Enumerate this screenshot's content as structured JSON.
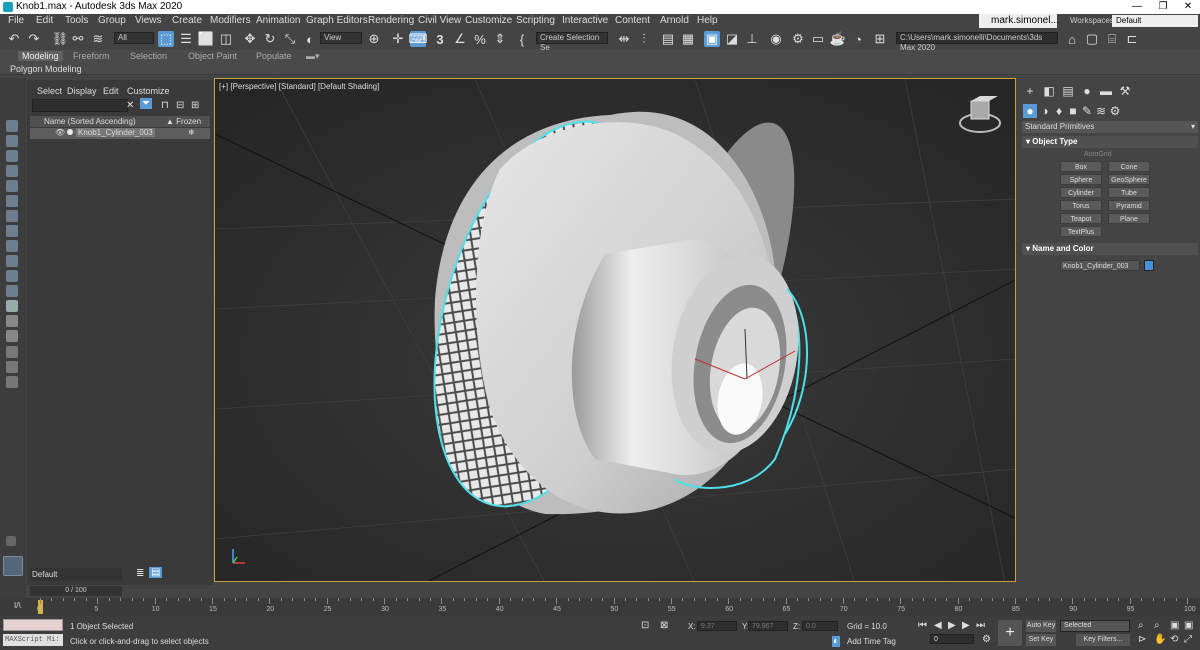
{
  "titlebar": {
    "title": "Knob1.max - Autodesk 3ds Max 2020",
    "minimize": "—",
    "maximize": "❐",
    "close": "✕"
  },
  "menus": [
    "File",
    "Edit",
    "Tools",
    "Group",
    "Views",
    "Create",
    "Modifiers",
    "Animation",
    "Graph Editors",
    "Rendering",
    "Civil View",
    "Customize",
    "Scripting",
    "Interactive",
    "Content",
    "Arnold",
    "Help"
  ],
  "user": {
    "name": "mark.simonel..."
  },
  "workspaces": {
    "label": "Workspaces:",
    "value": "Default"
  },
  "toolbar": {
    "filter_value": "All",
    "refcoord_value": "View",
    "snap_label": "3",
    "selection_set_placeholder": "Create Selection Se",
    "path": "C:\\Users\\mark.simonelli\\Documents\\3ds Max 2020"
  },
  "ribbon": {
    "tabs": [
      "Modeling",
      "Freeform",
      "Selection",
      "Object Paint",
      "Populate"
    ],
    "subtitle": "Polygon Modeling"
  },
  "scene_explorer": {
    "menus": [
      "Select",
      "Display",
      "Edit",
      "Customize"
    ],
    "col_name": "Name (Sorted Ascending)",
    "col_frozen": "▲ Frozen",
    "row_name": "Knob1_Cylinder_003",
    "layer": "Default"
  },
  "viewport": {
    "label": "[+] [Perspective] [Standard] [Default Shading]"
  },
  "command_panel": {
    "dropdown": "Standard Primitives",
    "rollout_object_type": "Object Type",
    "autogrid": "AutoGrid",
    "primitives": [
      "Box",
      "Cone",
      "Sphere",
      "GeoSphere",
      "Cylinder",
      "Tube",
      "Torus",
      "Pyramid",
      "Teapot",
      "Plane",
      "TextPlus"
    ],
    "rollout_name_color": "Name and Color",
    "object_name": "Knob1_Cylinder_003",
    "object_color": "#4a90d9"
  },
  "timeline": {
    "frame_label": "0 / 100",
    "ticks": [
      "0",
      "5",
      "10",
      "15",
      "20",
      "25",
      "30",
      "35",
      "40",
      "45",
      "50",
      "55",
      "60",
      "65",
      "70",
      "75",
      "80",
      "85",
      "90",
      "95",
      "100"
    ]
  },
  "status": {
    "maxscript": "MAXScript Mi:",
    "objects_selected": "1 Object Selected",
    "prompt": "Click or click-and-drag to select objects",
    "x_label": "X:",
    "x_value": "9.37",
    "y_label": "Y:",
    "y_value": "79.967",
    "z_label": "Z:",
    "z_value": "0.0",
    "grid": "Grid = 10.0",
    "add_time_tag": "Add Time Tag",
    "auto_key": "Auto Key",
    "set_key": "Set Key",
    "selected": "Selected",
    "key_filters": "Key Filters...",
    "frame": "0"
  }
}
